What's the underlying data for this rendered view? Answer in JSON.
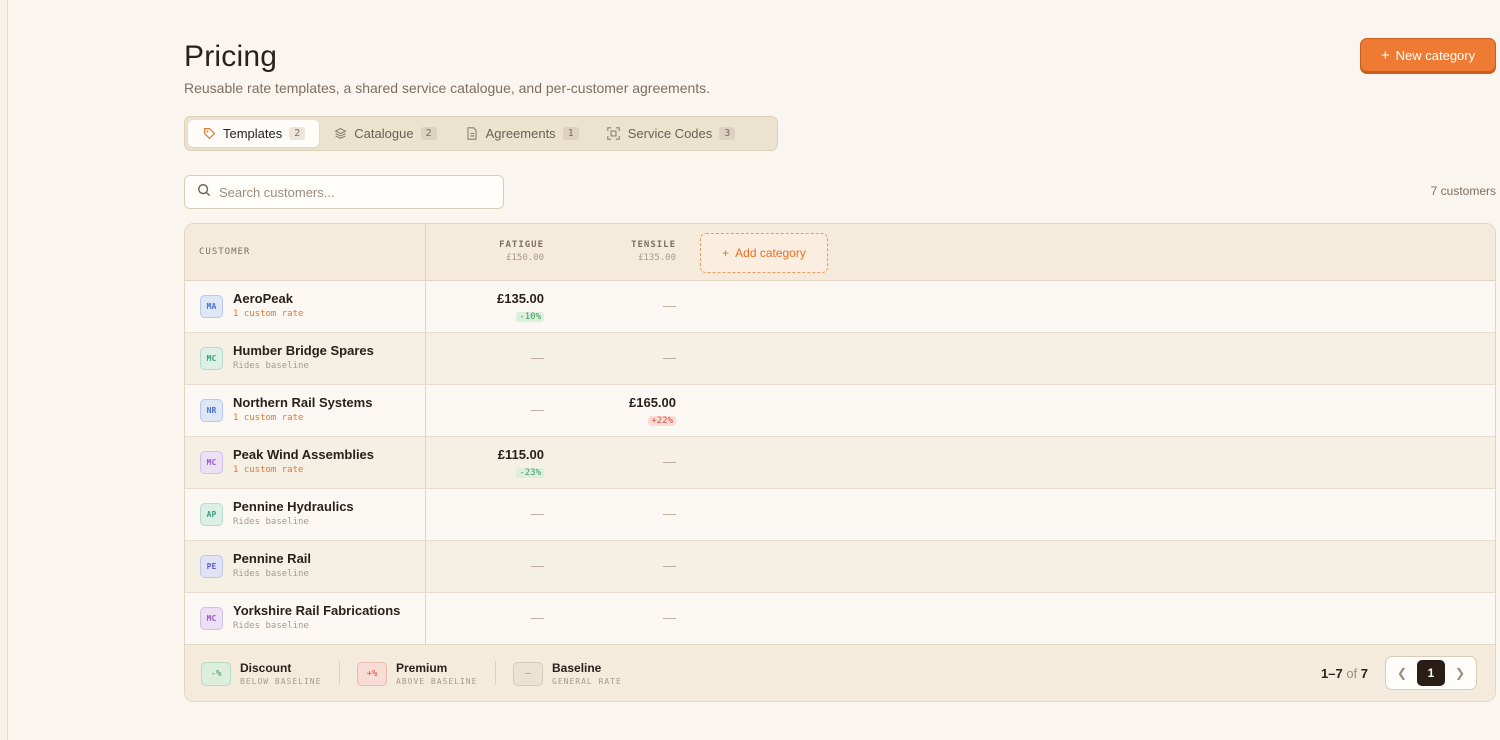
{
  "header": {
    "title": "Pricing",
    "subtitle": "Reusable rate templates, a shared service catalogue, and per-customer agreements.",
    "new_button": "New category"
  },
  "tabs": [
    {
      "label": "Templates",
      "count": "2",
      "icon": "tag-icon"
    },
    {
      "label": "Catalogue",
      "count": "2",
      "icon": "layers-icon"
    },
    {
      "label": "Agreements",
      "count": "1",
      "icon": "document-icon"
    },
    {
      "label": "Service Codes",
      "count": "3",
      "icon": "scan-icon"
    }
  ],
  "search": {
    "placeholder": "Search customers..."
  },
  "customer_count": "7 customers",
  "table": {
    "customer_header": "CUSTOMER",
    "categories": [
      {
        "name": "FATIGUE",
        "baseline": "£150.00"
      },
      {
        "name": "TENSILE",
        "baseline": "£135.00"
      }
    ],
    "add_category": "Add category",
    "rows": [
      {
        "initials": "MA",
        "name": "AeroPeak",
        "sub": "1 custom rate",
        "fatigue": {
          "price": "£135.00",
          "delta": "-10%"
        },
        "tensile": {
          "dash": "—"
        }
      },
      {
        "initials": "MC",
        "name": "Humber Bridge Spares",
        "sub": "Rides baseline",
        "fatigue": {
          "dash": "—"
        },
        "tensile": {
          "dash": "—"
        }
      },
      {
        "initials": "NR",
        "name": "Northern Rail Systems",
        "sub": "1 custom rate",
        "fatigue": {
          "dash": "—"
        },
        "tensile": {
          "price": "£165.00",
          "delta": "+22%"
        }
      },
      {
        "initials": "MC",
        "name": "Peak Wind Assemblies",
        "sub": "1 custom rate",
        "fatigue": {
          "price": "£115.00",
          "delta": "-23%"
        },
        "tensile": {
          "dash": "—"
        }
      },
      {
        "initials": "AP",
        "name": "Pennine Hydraulics",
        "sub": "Rides baseline",
        "fatigue": {
          "dash": "—"
        },
        "tensile": {
          "dash": "—"
        }
      },
      {
        "initials": "PE",
        "name": "Pennine Rail",
        "sub": "Rides baseline",
        "fatigue": {
          "dash": "—"
        },
        "tensile": {
          "dash": "—"
        }
      },
      {
        "initials": "MC",
        "name": "Yorkshire Rail Fabrications",
        "sub": "Rides baseline",
        "fatigue": {
          "dash": "—"
        },
        "tensile": {
          "dash": "—"
        }
      }
    ]
  },
  "legend": [
    {
      "swatch": "-%",
      "title": "Discount",
      "sub": "BELOW BASELINE"
    },
    {
      "swatch": "+%",
      "title": "Premium",
      "sub": "ABOVE BASELINE"
    },
    {
      "swatch": "—",
      "title": "Baseline",
      "sub": "GENERAL RATE"
    }
  ],
  "pagination": {
    "range": "1–7",
    "of": "of",
    "total": "7",
    "current": "1"
  },
  "colors": {
    "accent": "#ee7a33",
    "discount": "#3d9a55",
    "premium": "#d9533f"
  }
}
